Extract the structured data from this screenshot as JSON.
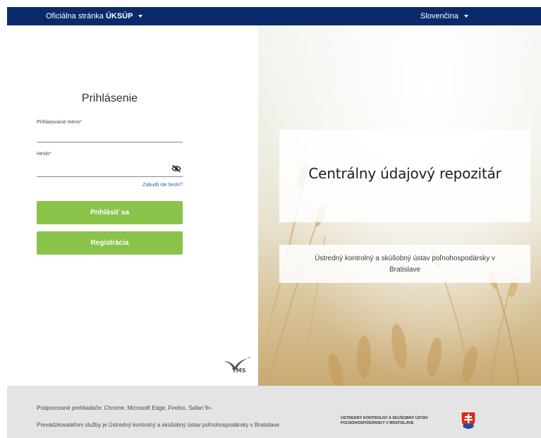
{
  "topbar": {
    "official_prefix": "Oficiálna stránka",
    "official_org": "ÚKSÚP",
    "language": "Slovenčina",
    "background_color": "#0a2a6b"
  },
  "login": {
    "title": "Prihlásenie",
    "username_label": "Prihlasovacie meno",
    "password_label": "Heslo",
    "required_mark": "*",
    "forgot_password": "Zabudli ste heslo?",
    "login_button": "Prihlásiť sa",
    "register_button": "Registrácia",
    "button_color": "#8bc34a"
  },
  "brand_logo": {
    "icon": "yms-logo-icon"
  },
  "hero": {
    "title": "Centrálny údajový repozitár",
    "subtitle": "Ústredný kontrolný a skúšobný ústav poľnohospodársky v Bratislave"
  },
  "footer": {
    "browsers": "Podporované prehliadače: Chrome, Microsoft Edge, Firefox, Safari 9+.",
    "operator": "Prevádzkovateľom služby je Ústredný kontrolný a skúšobný ústav poľnohospodársky v Bratislave",
    "org_line1": "ÚSTREDNÝ KONTROLNÝ A SKÚŠOBNÝ ÚSTAV",
    "org_line2": "POĽNOHOSPODÁRSKY V BRATISLAVE",
    "crest_icon": "slovak-coat-of-arms-icon"
  }
}
